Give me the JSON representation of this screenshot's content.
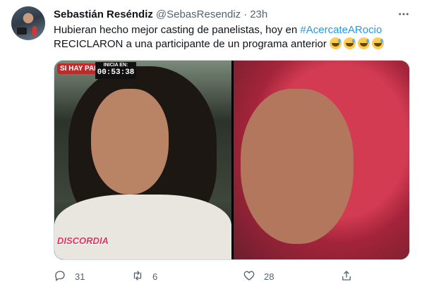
{
  "tweet": {
    "author_name": "Sebastián Reséndiz",
    "author_handle": "@SebasResendiz",
    "separator": "·",
    "time": "23h",
    "text_before": "Hubieran hecho mejor casting de panelistas, hoy en ",
    "hashtag": "#AcercateARocio",
    "text_after": "RECICLARON a una participante de un programa anterior",
    "emoji": [
      "grinning-sweat-emoji",
      "grinning-sweat-emoji",
      "grinning-sweat-emoji",
      "grinning-sweat-emoji"
    ]
  },
  "media": {
    "left_image": {
      "show_logo": "SI HAY PARAÍSO",
      "clock_label": "INICIA EN:",
      "clock_time": "00:53:38",
      "bottom_logo": "DISCORDIA"
    }
  },
  "actions": {
    "reply_count": "31",
    "retweet_count": "6",
    "like_count": "28"
  },
  "colors": {
    "text": "#0f1419",
    "secondary": "#536471",
    "link": "#1d9bf0",
    "border": "#cfd9de"
  },
  "icons": [
    "reply-icon",
    "retweet-icon",
    "like-icon",
    "share-icon",
    "more-icon"
  ]
}
